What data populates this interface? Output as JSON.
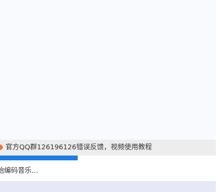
{
  "notice": {
    "text": "官方QQ群126196126错误反馈，视频使用教程",
    "icon": "info-dot-icon",
    "icon_color": "#e8773a"
  },
  "progress": {
    "value_fraction": 0.36,
    "fill_color": "#1c7ce8"
  },
  "status": {
    "text": "始编码音乐..."
  },
  "colors": {
    "content_bg": "#f8fafd",
    "notice_bg": "#ededed",
    "bottom_bar_bg": "#e6e8f8"
  }
}
